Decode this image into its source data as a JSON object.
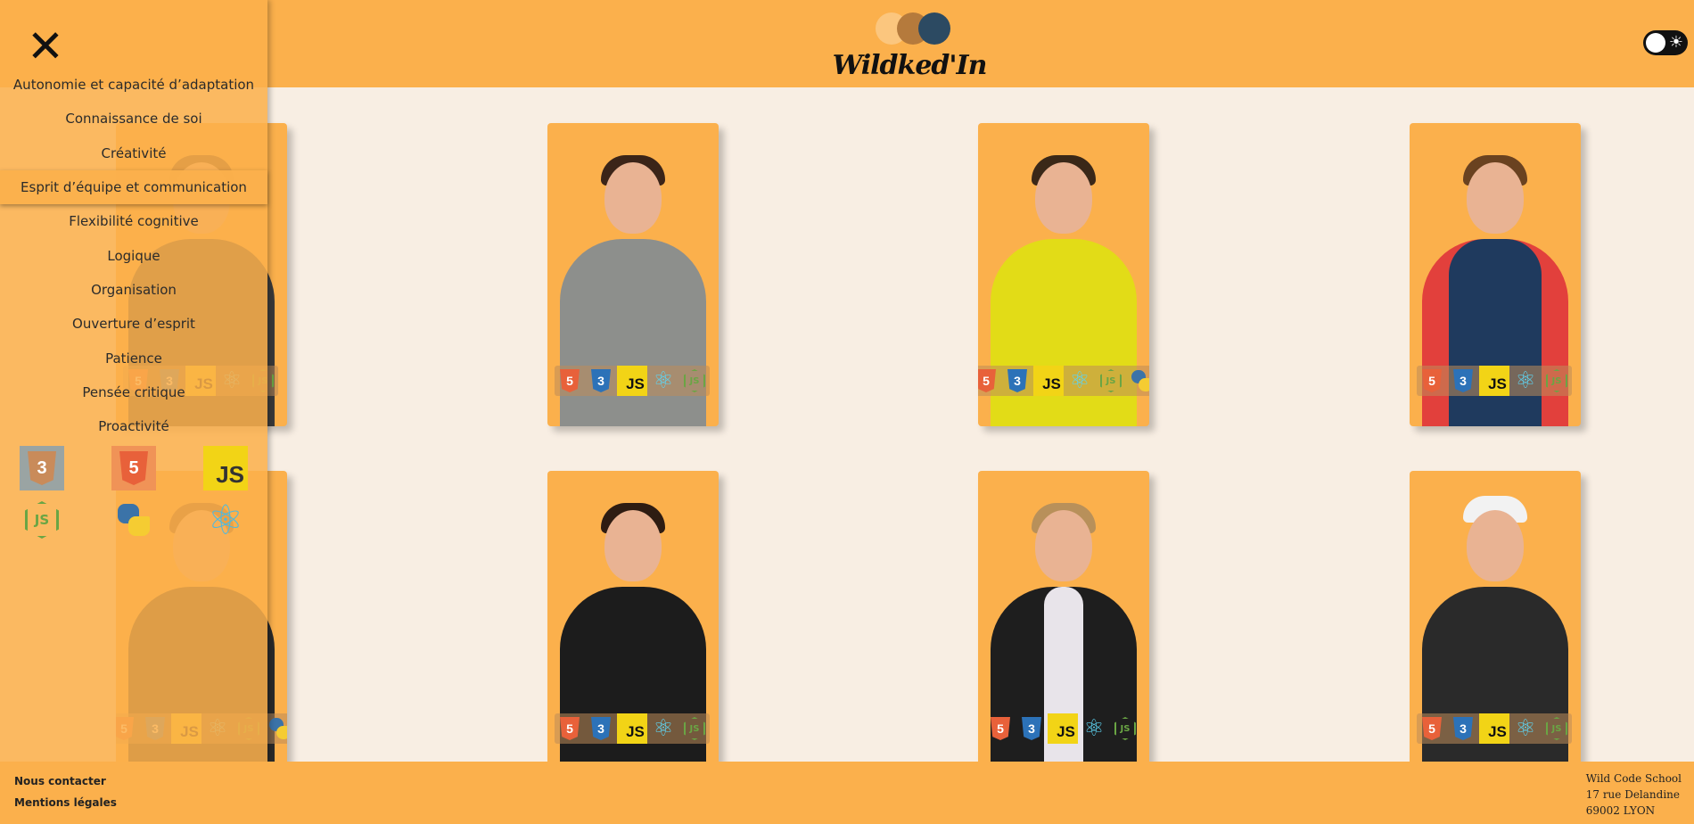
{
  "header": {
    "logo_text": "Wildked'In",
    "logo_colors": [
      "#fbc67e",
      "#b57a3c",
      "#2c4a62"
    ]
  },
  "theme_toggle": {
    "icon": "sun-icon",
    "state": "light"
  },
  "sidebar": {
    "close_icon": "close-icon",
    "menu": [
      "Autonomie et capacité d’adaptation",
      "Connaissance de soi",
      "Créativité",
      "Esprit d’équipe et communication",
      "Flexibilité cognitive",
      "Logique",
      "Organisation",
      "Ouverture d’esprit",
      "Patience",
      "Pensée critique",
      "Proactivité"
    ],
    "active_item": "Esprit d’équipe et communication",
    "tech_filters": [
      {
        "name": "css3-icon",
        "label": "3"
      },
      {
        "name": "html5-icon",
        "label": "5"
      },
      {
        "name": "javascript-icon",
        "label": "JS"
      },
      {
        "name": "nodejs-icon",
        "label": "JS"
      },
      {
        "name": "python-icon",
        "label": ""
      },
      {
        "name": "react-icon",
        "label": "⚛"
      }
    ]
  },
  "cards": [
    {
      "id": "card-1",
      "badges": [
        "html5",
        "css3",
        "js",
        "react",
        "node"
      ]
    },
    {
      "id": "card-2",
      "badges": [
        "html5",
        "css3",
        "js",
        "react",
        "node",
        "python"
      ]
    },
    {
      "id": "card-3",
      "badges": [
        "html5",
        "css3",
        "js",
        "react",
        "node"
      ]
    },
    {
      "id": "card-4",
      "badges": [
        "html5",
        "css3",
        "js",
        "react",
        "node"
      ]
    },
    {
      "id": "card-5",
      "badges": [
        "html5",
        "css3",
        "js",
        "react",
        "node"
      ]
    },
    {
      "id": "card-6",
      "badges": [
        "html5",
        "css3",
        "js",
        "react",
        "node"
      ]
    },
    {
      "id": "card-7",
      "badges": [
        "html5",
        "css3",
        "js",
        "react",
        "node"
      ]
    },
    {
      "id": "card-8",
      "badges": [
        "html5",
        "css3",
        "js",
        "react",
        "node",
        "python"
      ]
    }
  ],
  "badge_text": {
    "html5": "5",
    "css3": "3",
    "js": "JS",
    "react": "⚛",
    "node": "JS"
  },
  "footer": {
    "contact": "Nous contacter",
    "legal": "Mentions légales",
    "address_lines": [
      "Wild Code School",
      "17 rue Delandine",
      "69002 LYON"
    ]
  }
}
